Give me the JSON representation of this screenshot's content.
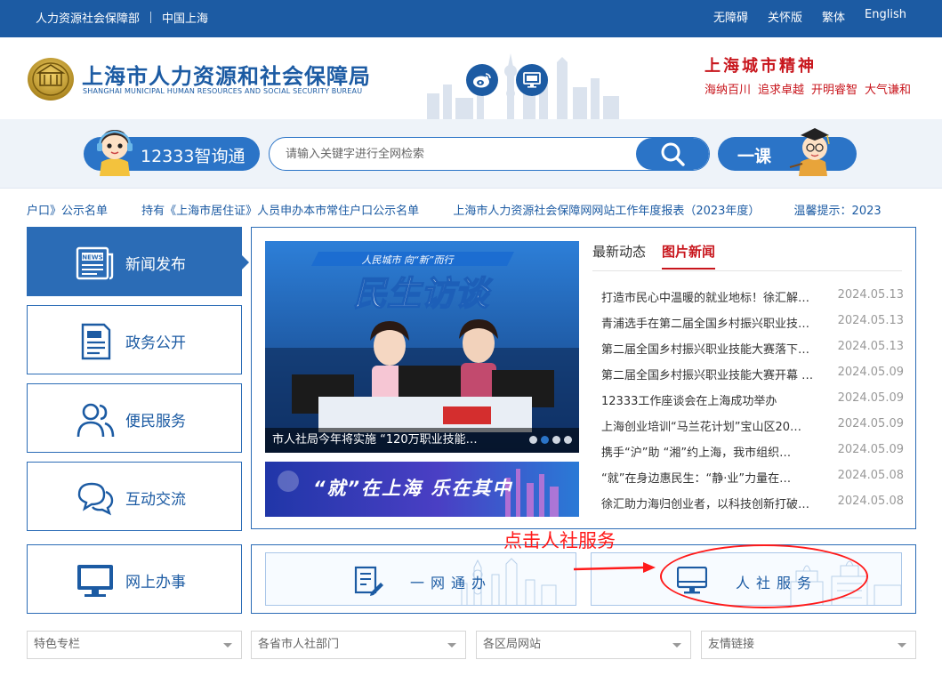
{
  "topbar": {
    "left_links": [
      "人力资源社会保障部",
      "中国上海"
    ],
    "right_links": [
      "无障碍",
      "关怀版",
      "繁体",
      "English"
    ]
  },
  "header": {
    "title_cn": "上海市人力资源和社会保障局",
    "title_en": "SHANGHAI MUNICIPAL HUMAN RESOURCES AND SOCIAL SECURITY BUREAU",
    "icons": [
      "weibo-icon",
      "monitor-icon"
    ],
    "city_spirit_title": "上海城市精神",
    "city_spirit_items": [
      "海纳百川",
      "追求卓越",
      "开明睿智",
      "大气谦和"
    ]
  },
  "search": {
    "assistant_label": "12333智询通",
    "placeholder": "请输入关键字进行全网检索",
    "course_label": "一课"
  },
  "ticker": [
    "户口》公示名单",
    "持有《上海市居住证》人员申办本市常住户口公示名单",
    "上海市人力资源社会保障网网站工作年度报表（2023年度）",
    "温馨提示：2023"
  ],
  "nav": [
    {
      "label": "新闻发布",
      "icon": "newspaper-icon"
    },
    {
      "label": "政务公开",
      "icon": "document-icon"
    },
    {
      "label": "便民服务",
      "icon": "people-icon"
    },
    {
      "label": "互动交流",
      "icon": "chat-bubbles-icon"
    },
    {
      "label": "网上办事",
      "icon": "monitor-icon"
    }
  ],
  "news": {
    "photo_banner_text": "民生访谈",
    "photo_banner_tagline": "人民城市 向“新”而行",
    "photo_caption": "市人社局今年将实施 “120万职业技能…",
    "banner2_text": "“就”在上海 乐在其中",
    "tabs": [
      "最新动态",
      "图片新闻"
    ],
    "active_tab": "图片新闻",
    "items": [
      {
        "title": "打造市民心中温暖的就业地标！徐汇解…",
        "date": "2024.05.13"
      },
      {
        "title": "青浦选手在第二届全国乡村振兴职业技…",
        "date": "2024.05.13"
      },
      {
        "title": "第二届全国乡村振兴职业技能大赛落下…",
        "date": "2024.05.13"
      },
      {
        "title": "第二届全国乡村振兴职业技能大赛开幕 …",
        "date": "2024.05.09"
      },
      {
        "title": "12333工作座谈会在上海成功举办",
        "date": "2024.05.09"
      },
      {
        "title": "上海创业培训“马兰花计划”宝山区20…",
        "date": "2024.05.09"
      },
      {
        "title": "携手“沪”助 “湘”约上海，我市组织…",
        "date": "2024.05.09"
      },
      {
        "title": "“就”在身边惠民生：“静·业”力量在…",
        "date": "2024.05.08"
      },
      {
        "title": "徐汇助力海归创业者，以科技创新打破…",
        "date": "2024.05.08"
      }
    ]
  },
  "services": {
    "left_label": "一网通办",
    "right_label": "人社服务"
  },
  "annotation": {
    "text": "点击人社服务",
    "color": "#ff1a1a"
  },
  "footer_dropdowns": [
    "特色专栏",
    "各省市人社部门",
    "各区局网站",
    "友情链接"
  ],
  "colors": {
    "primary": "#1c5ba3",
    "accent_red": "#c8161d"
  }
}
